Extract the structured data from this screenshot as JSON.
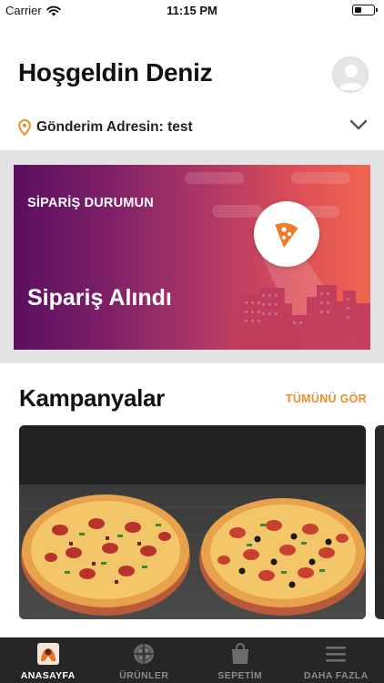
{
  "status_bar": {
    "carrier": "Carrier",
    "time": "11:15 PM"
  },
  "header": {
    "greeting": "Hoşgeldin Deniz"
  },
  "address": {
    "label": "Gönderim Adresin: test"
  },
  "order": {
    "label": "SİPARİŞ DURUMUN",
    "status": "Sipariş Alındı"
  },
  "campaigns": {
    "title": "Kampanyalar",
    "see_all": "TÜMÜNÜ GÖR"
  },
  "tabs": [
    {
      "label": "ANASAYFA",
      "icon": "home-logo-icon",
      "active": true
    },
    {
      "label": "ÜRÜNLER",
      "icon": "pizza-icon",
      "active": false
    },
    {
      "label": "SEPETİM",
      "icon": "bag-icon",
      "active": false
    },
    {
      "label": "DAHA FAZLA",
      "icon": "menu-icon",
      "active": false
    }
  ],
  "colors": {
    "accent": "#f08a2a",
    "tab_bar": "#262626",
    "banner_start": "#5a0f5e",
    "banner_end": "#f06650"
  }
}
